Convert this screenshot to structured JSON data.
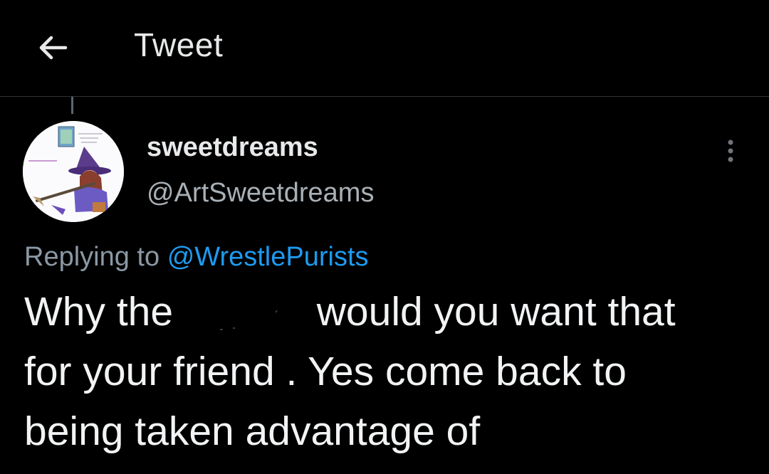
{
  "header": {
    "title": "Tweet",
    "back_icon": "arrow-left-icon"
  },
  "author": {
    "display_name": "sweetdreams",
    "handle": "@ArtSweetdreams",
    "avatar_icon": "anime-witch-avatar"
  },
  "reply": {
    "prefix": "Replying to",
    "mention": "@WrestlePurists"
  },
  "tweet": {
    "line1_start": "Why the",
    "line1_end": "would you want that",
    "line2": "for your friend . Yes come back to",
    "line3": "being taken advantage of"
  },
  "colors": {
    "background": "#000000",
    "text": "#e7e9ea",
    "secondary_text": "#8b98a5",
    "link": "#1d9bf0",
    "divider": "#2f3336"
  }
}
